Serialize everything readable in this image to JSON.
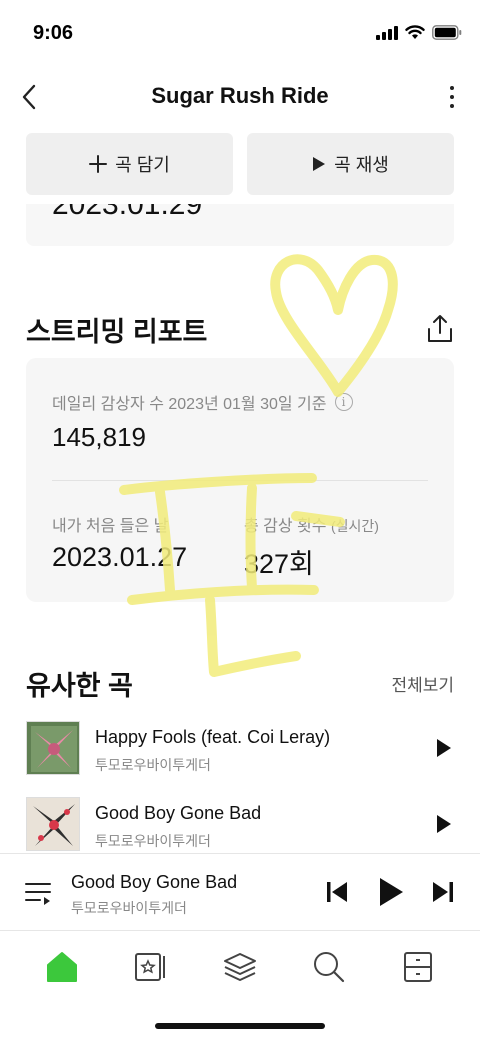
{
  "status_bar": {
    "time": "9:06"
  },
  "header": {
    "title": "Sugar Rush Ride"
  },
  "actions": {
    "add_label": "곡 담기",
    "play_label": "곡 재생"
  },
  "previous_card": {
    "partial_text": "2023.01.29"
  },
  "streaming_report": {
    "title": "스트리밍 리포트",
    "daily_listeners_label": "데일리 감상자 수 2023년 01월 30일 기준",
    "daily_listeners_value": "145,819",
    "first_listen_label": "내가 처음 들은 날",
    "first_listen_value": "2023.01.27",
    "total_plays_label": "총 감상 횟수",
    "total_plays_sub": "(실시간)",
    "total_plays_value": "327회"
  },
  "similar": {
    "title": "유사한 곡",
    "see_all": "전체보기",
    "songs": [
      {
        "title": "Happy Fools (feat. Coi Leray)",
        "artist": "투모로우바이투게더"
      },
      {
        "title": "Good Boy Gone Bad",
        "artist": "투모로우바이투게더"
      }
    ]
  },
  "mini_player": {
    "title": "Good Boy Gone Bad",
    "artist": "투모로우바이투게더"
  },
  "icons": {
    "tabs": [
      "home-icon",
      "library-icon",
      "layers-icon",
      "search-icon",
      "drawer-icon"
    ],
    "active_color": "#3cc83c",
    "doodle_color": "#f2ec7a"
  },
  "doodle": {
    "handwriting": "핀"
  }
}
